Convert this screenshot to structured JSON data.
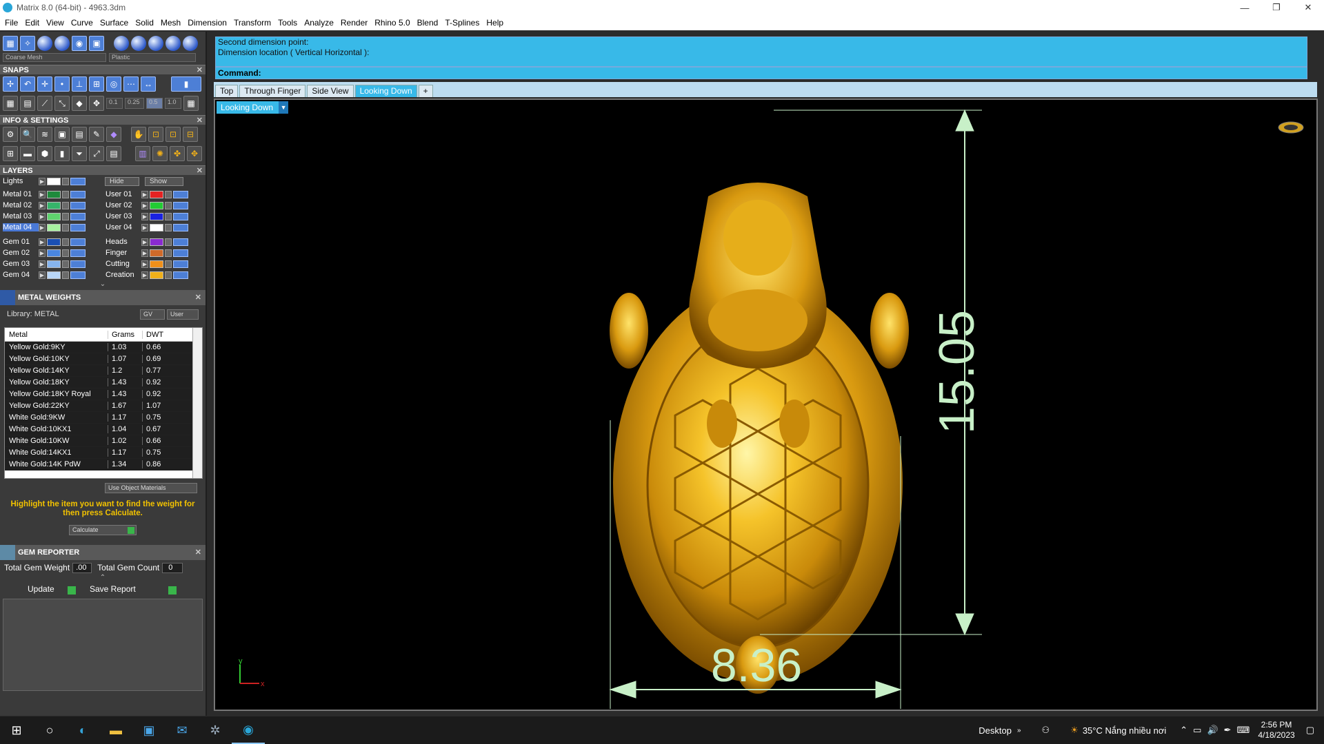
{
  "window": {
    "title": "Matrix 8.0 (64-bit) - 4963.3dm"
  },
  "menu": [
    "File",
    "Edit",
    "View",
    "Curve",
    "Surface",
    "Solid",
    "Mesh",
    "Dimension",
    "Transform",
    "Tools",
    "Analyze",
    "Render",
    "Rhino 5.0",
    "Blend",
    "T-Splines",
    "Help"
  ],
  "display": {
    "mesh_combo": "Coarse Mesh",
    "material_combo": "Plastic"
  },
  "snaps": {
    "title": "SNAPS",
    "values": [
      "0.1",
      "0.25",
      "0.5",
      "1.0"
    ]
  },
  "info_settings": {
    "title": "INFO & SETTINGS"
  },
  "layers": {
    "title": "LAYERS",
    "lights_label": "Lights",
    "hide_label": "Hide",
    "show_label": "Show",
    "left": [
      {
        "name": "Metal 01",
        "color": "#1e8a3c"
      },
      {
        "name": "Metal 02",
        "color": "#36b46a"
      },
      {
        "name": "Metal 03",
        "color": "#5fd36e"
      },
      {
        "name": "Metal 04",
        "color": "#a8f0a0",
        "selected": true
      },
      {
        "name": "Gem 01",
        "color": "#1a4fb3"
      },
      {
        "name": "Gem 02",
        "color": "#4a86e0"
      },
      {
        "name": "Gem 03",
        "color": "#86b4ee"
      },
      {
        "name": "Gem 04",
        "color": "#b9d6f7"
      }
    ],
    "right": [
      {
        "name": "User 01",
        "color": "#e52222"
      },
      {
        "name": "User 02",
        "color": "#22cc33"
      },
      {
        "name": "User 03",
        "color": "#1a22e0"
      },
      {
        "name": "User 04",
        "color": "#ffffff"
      },
      {
        "name": "Heads",
        "color": "#8a2ad0"
      },
      {
        "name": "Finger",
        "color": "#d06a2a"
      },
      {
        "name": "Cutting",
        "color": "#f0901a"
      },
      {
        "name": "Creation",
        "color": "#f0b01a"
      }
    ]
  },
  "metal_weights": {
    "title": "METAL WEIGHTS",
    "library_label": "Library: METAL",
    "gv_label": "GV",
    "user_label": "User",
    "columns": [
      "Metal",
      "Grams",
      "DWT"
    ],
    "rows": [
      [
        "Yellow Gold:9KY",
        "1.03",
        "0.66"
      ],
      [
        "Yellow Gold:10KY",
        "1.07",
        "0.69"
      ],
      [
        "Yellow Gold:14KY",
        "1.2",
        "0.77"
      ],
      [
        "Yellow Gold:18KY",
        "1.43",
        "0.92"
      ],
      [
        "Yellow Gold:18KY Royal",
        "1.43",
        "0.92"
      ],
      [
        "Yellow Gold:22KY",
        "1.67",
        "1.07"
      ],
      [
        "White Gold:9KW",
        "1.17",
        "0.75"
      ],
      [
        "White Gold:10KX1",
        "1.04",
        "0.67"
      ],
      [
        "White Gold:10KW",
        "1.02",
        "0.66"
      ],
      [
        "White Gold:14KX1",
        "1.17",
        "0.75"
      ],
      [
        "White Gold:14K PdW",
        "1.34",
        "0.86"
      ]
    ],
    "use_object_materials": "Use Object Materials",
    "hint": "Highlight the item you want to find the weight for then press Calculate.",
    "calculate": "Calculate"
  },
  "gem_reporter": {
    "title": "GEM REPORTER",
    "total_weight_label": "Total Gem Weight",
    "total_weight_value": ".00",
    "total_count_label": "Total Gem Count",
    "total_count_value": "0",
    "update": "Update",
    "save_report": "Save Report"
  },
  "command": {
    "line1": "Second dimension point:",
    "line2": "Dimension location ( Vertical  Horizontal ):",
    "prompt": "Command:"
  },
  "view_tabs": [
    "Top",
    "Through Finger",
    "Side View",
    "Looking Down",
    "+"
  ],
  "viewport": {
    "label": "Looking Down",
    "dim_vertical": "15.05",
    "dim_horizontal": "8.36",
    "axis_y": "y",
    "axis_x": "x"
  },
  "taskbar": {
    "desktop": "Desktop",
    "weather": "35°C  Nắng nhiều nơi",
    "time": "2:56 PM",
    "date": "4/18/2023"
  }
}
